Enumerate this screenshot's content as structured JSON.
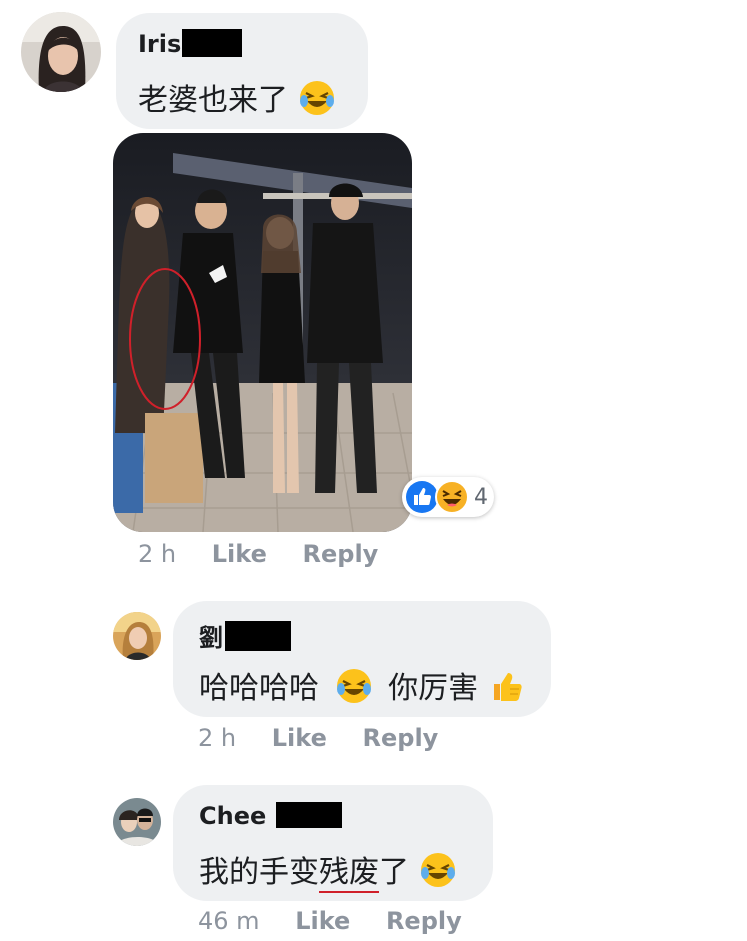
{
  "comments": [
    {
      "author": "Iris",
      "text": "老婆也来了",
      "time": "2 h",
      "like": "Like",
      "reply": "Reply",
      "reaction_count": "4"
    },
    {
      "author": "劉",
      "text_a": "哈哈哈哈",
      "text_b": "你厉害",
      "time": "2 h",
      "like": "Like",
      "reply": "Reply"
    },
    {
      "author": "Chee",
      "text_a": "我的手变",
      "text_b": "残废",
      "text_c": "了",
      "time": "46 m",
      "like": "Like",
      "reply": "Reply"
    }
  ],
  "icons": {
    "laugh": "laughing-tears-emoji",
    "thumbs": "thumbs-up-emoji",
    "like_reaction": "like-reaction-icon",
    "haha_reaction": "haha-reaction-icon"
  },
  "colors": {
    "bubble": "#eef0f2",
    "meta": "#8d949e",
    "like_blue": "#1877f2",
    "annotation_red": "#d0202a"
  }
}
